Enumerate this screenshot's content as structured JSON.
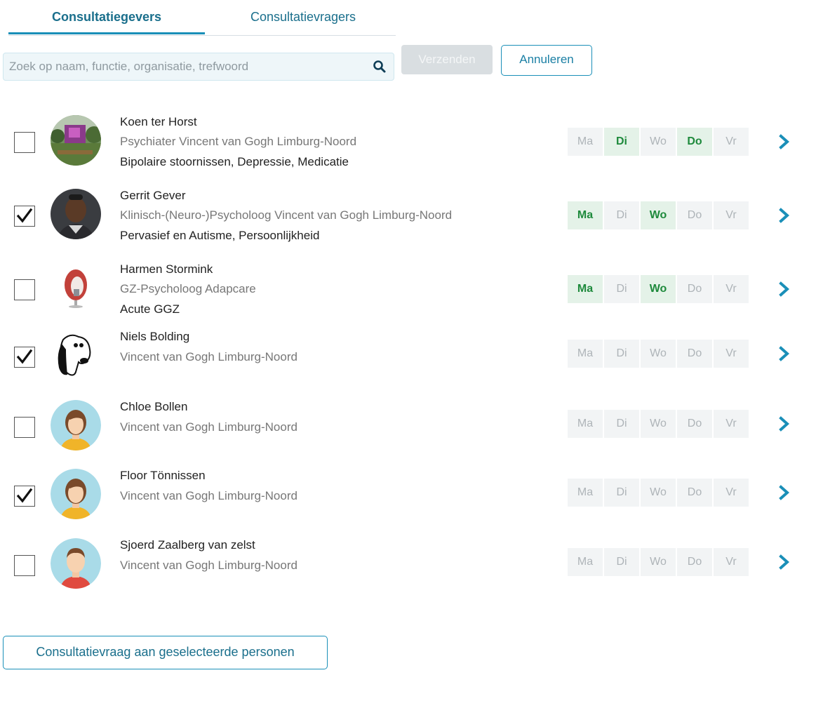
{
  "tabs": [
    {
      "label": "Consultatiegevers",
      "active": true
    },
    {
      "label": "Consultatievragers",
      "active": false
    }
  ],
  "search": {
    "placeholder": "Zoek op naam, functie, organisatie, trefwoord",
    "value": ""
  },
  "actions": {
    "send_label": "Verzenden",
    "cancel_label": "Annuleren"
  },
  "day_labels": [
    "Ma",
    "Di",
    "Wo",
    "Do",
    "Vr"
  ],
  "people": [
    {
      "name": "Koen ter Horst",
      "function": "Psychiater Vincent van Gogh Limburg-Noord",
      "tags": "Bipolaire stoornissen, Depressie, Medicatie",
      "checked": false,
      "avatar": "landscape-photo",
      "days_on": [
        "Di",
        "Do"
      ]
    },
    {
      "name": "Gerrit Gever",
      "function": "Klinisch-(Neuro-)Psycholoog Vincent van Gogh Limburg-Noord",
      "tags": "Pervasief en Autisme, Persoonlijkheid",
      "checked": true,
      "avatar": "portrait-photo",
      "days_on": [
        "Ma",
        "Wo"
      ]
    },
    {
      "name": "Harmen Stormink",
      "function": "GZ-Psycholoog Adapcare",
      "tags": "Acute GGZ",
      "checked": false,
      "avatar": "egg-chair-photo",
      "days_on": [
        "Ma",
        "Wo"
      ]
    },
    {
      "name": "Niels Bolding",
      "function": "Vincent van Gogh Limburg-Noord",
      "tags": "",
      "checked": true,
      "avatar": "cartoon-dog",
      "days_on": []
    },
    {
      "name": "Chloe Bollen",
      "function": "Vincent van Gogh Limburg-Noord",
      "tags": "",
      "checked": false,
      "avatar": "default-female",
      "days_on": []
    },
    {
      "name": "Floor Tönnissen",
      "function": "Vincent van Gogh Limburg-Noord",
      "tags": "",
      "checked": true,
      "avatar": "default-female",
      "days_on": []
    },
    {
      "name": "Sjoerd Zaalberg van zelst",
      "function": "Vincent van Gogh Limburg-Noord",
      "tags": "",
      "checked": false,
      "avatar": "default-male",
      "days_on": []
    }
  ],
  "bottom_button_label": "Consultatievraag aan geselecteerde personen",
  "colors": {
    "accent": "#1a8fb8",
    "tab_text": "#1a6f8c",
    "day_on_bg": "#e4f2e8",
    "day_on_text": "#1e8a3c",
    "day_off_bg": "#f2f4f5"
  },
  "icons": {
    "search": "search-icon",
    "row_action": "chevron-right-icon",
    "check": "checkmark-icon"
  }
}
